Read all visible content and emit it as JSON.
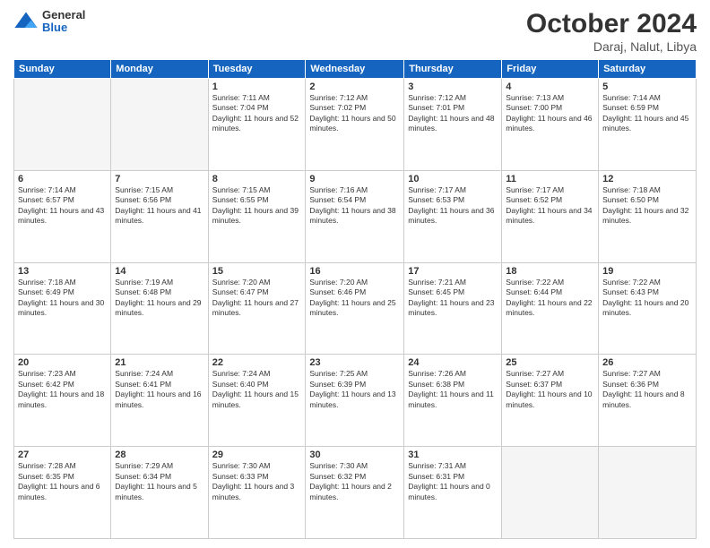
{
  "header": {
    "logo_line1": "General",
    "logo_line2": "Blue",
    "month": "October 2024",
    "location": "Daraj, Nalut, Libya"
  },
  "weekdays": [
    "Sunday",
    "Monday",
    "Tuesday",
    "Wednesday",
    "Thursday",
    "Friday",
    "Saturday"
  ],
  "weeks": [
    [
      {
        "day": "",
        "empty": true
      },
      {
        "day": "",
        "empty": true
      },
      {
        "day": "1",
        "sunrise": "Sunrise: 7:11 AM",
        "sunset": "Sunset: 7:04 PM",
        "daylight": "Daylight: 11 hours and 52 minutes."
      },
      {
        "day": "2",
        "sunrise": "Sunrise: 7:12 AM",
        "sunset": "Sunset: 7:02 PM",
        "daylight": "Daylight: 11 hours and 50 minutes."
      },
      {
        "day": "3",
        "sunrise": "Sunrise: 7:12 AM",
        "sunset": "Sunset: 7:01 PM",
        "daylight": "Daylight: 11 hours and 48 minutes."
      },
      {
        "day": "4",
        "sunrise": "Sunrise: 7:13 AM",
        "sunset": "Sunset: 7:00 PM",
        "daylight": "Daylight: 11 hours and 46 minutes."
      },
      {
        "day": "5",
        "sunrise": "Sunrise: 7:14 AM",
        "sunset": "Sunset: 6:59 PM",
        "daylight": "Daylight: 11 hours and 45 minutes."
      }
    ],
    [
      {
        "day": "6",
        "sunrise": "Sunrise: 7:14 AM",
        "sunset": "Sunset: 6:57 PM",
        "daylight": "Daylight: 11 hours and 43 minutes."
      },
      {
        "day": "7",
        "sunrise": "Sunrise: 7:15 AM",
        "sunset": "Sunset: 6:56 PM",
        "daylight": "Daylight: 11 hours and 41 minutes."
      },
      {
        "day": "8",
        "sunrise": "Sunrise: 7:15 AM",
        "sunset": "Sunset: 6:55 PM",
        "daylight": "Daylight: 11 hours and 39 minutes."
      },
      {
        "day": "9",
        "sunrise": "Sunrise: 7:16 AM",
        "sunset": "Sunset: 6:54 PM",
        "daylight": "Daylight: 11 hours and 38 minutes."
      },
      {
        "day": "10",
        "sunrise": "Sunrise: 7:17 AM",
        "sunset": "Sunset: 6:53 PM",
        "daylight": "Daylight: 11 hours and 36 minutes."
      },
      {
        "day": "11",
        "sunrise": "Sunrise: 7:17 AM",
        "sunset": "Sunset: 6:52 PM",
        "daylight": "Daylight: 11 hours and 34 minutes."
      },
      {
        "day": "12",
        "sunrise": "Sunrise: 7:18 AM",
        "sunset": "Sunset: 6:50 PM",
        "daylight": "Daylight: 11 hours and 32 minutes."
      }
    ],
    [
      {
        "day": "13",
        "sunrise": "Sunrise: 7:18 AM",
        "sunset": "Sunset: 6:49 PM",
        "daylight": "Daylight: 11 hours and 30 minutes."
      },
      {
        "day": "14",
        "sunrise": "Sunrise: 7:19 AM",
        "sunset": "Sunset: 6:48 PM",
        "daylight": "Daylight: 11 hours and 29 minutes."
      },
      {
        "day": "15",
        "sunrise": "Sunrise: 7:20 AM",
        "sunset": "Sunset: 6:47 PM",
        "daylight": "Daylight: 11 hours and 27 minutes."
      },
      {
        "day": "16",
        "sunrise": "Sunrise: 7:20 AM",
        "sunset": "Sunset: 6:46 PM",
        "daylight": "Daylight: 11 hours and 25 minutes."
      },
      {
        "day": "17",
        "sunrise": "Sunrise: 7:21 AM",
        "sunset": "Sunset: 6:45 PM",
        "daylight": "Daylight: 11 hours and 23 minutes."
      },
      {
        "day": "18",
        "sunrise": "Sunrise: 7:22 AM",
        "sunset": "Sunset: 6:44 PM",
        "daylight": "Daylight: 11 hours and 22 minutes."
      },
      {
        "day": "19",
        "sunrise": "Sunrise: 7:22 AM",
        "sunset": "Sunset: 6:43 PM",
        "daylight": "Daylight: 11 hours and 20 minutes."
      }
    ],
    [
      {
        "day": "20",
        "sunrise": "Sunrise: 7:23 AM",
        "sunset": "Sunset: 6:42 PM",
        "daylight": "Daylight: 11 hours and 18 minutes."
      },
      {
        "day": "21",
        "sunrise": "Sunrise: 7:24 AM",
        "sunset": "Sunset: 6:41 PM",
        "daylight": "Daylight: 11 hours and 16 minutes."
      },
      {
        "day": "22",
        "sunrise": "Sunrise: 7:24 AM",
        "sunset": "Sunset: 6:40 PM",
        "daylight": "Daylight: 11 hours and 15 minutes."
      },
      {
        "day": "23",
        "sunrise": "Sunrise: 7:25 AM",
        "sunset": "Sunset: 6:39 PM",
        "daylight": "Daylight: 11 hours and 13 minutes."
      },
      {
        "day": "24",
        "sunrise": "Sunrise: 7:26 AM",
        "sunset": "Sunset: 6:38 PM",
        "daylight": "Daylight: 11 hours and 11 minutes."
      },
      {
        "day": "25",
        "sunrise": "Sunrise: 7:27 AM",
        "sunset": "Sunset: 6:37 PM",
        "daylight": "Daylight: 11 hours and 10 minutes."
      },
      {
        "day": "26",
        "sunrise": "Sunrise: 7:27 AM",
        "sunset": "Sunset: 6:36 PM",
        "daylight": "Daylight: 11 hours and 8 minutes."
      }
    ],
    [
      {
        "day": "27",
        "sunrise": "Sunrise: 7:28 AM",
        "sunset": "Sunset: 6:35 PM",
        "daylight": "Daylight: 11 hours and 6 minutes."
      },
      {
        "day": "28",
        "sunrise": "Sunrise: 7:29 AM",
        "sunset": "Sunset: 6:34 PM",
        "daylight": "Daylight: 11 hours and 5 minutes."
      },
      {
        "day": "29",
        "sunrise": "Sunrise: 7:30 AM",
        "sunset": "Sunset: 6:33 PM",
        "daylight": "Daylight: 11 hours and 3 minutes."
      },
      {
        "day": "30",
        "sunrise": "Sunrise: 7:30 AM",
        "sunset": "Sunset: 6:32 PM",
        "daylight": "Daylight: 11 hours and 2 minutes."
      },
      {
        "day": "31",
        "sunrise": "Sunrise: 7:31 AM",
        "sunset": "Sunset: 6:31 PM",
        "daylight": "Daylight: 11 hours and 0 minutes."
      },
      {
        "day": "",
        "empty": true
      },
      {
        "day": "",
        "empty": true
      }
    ]
  ]
}
